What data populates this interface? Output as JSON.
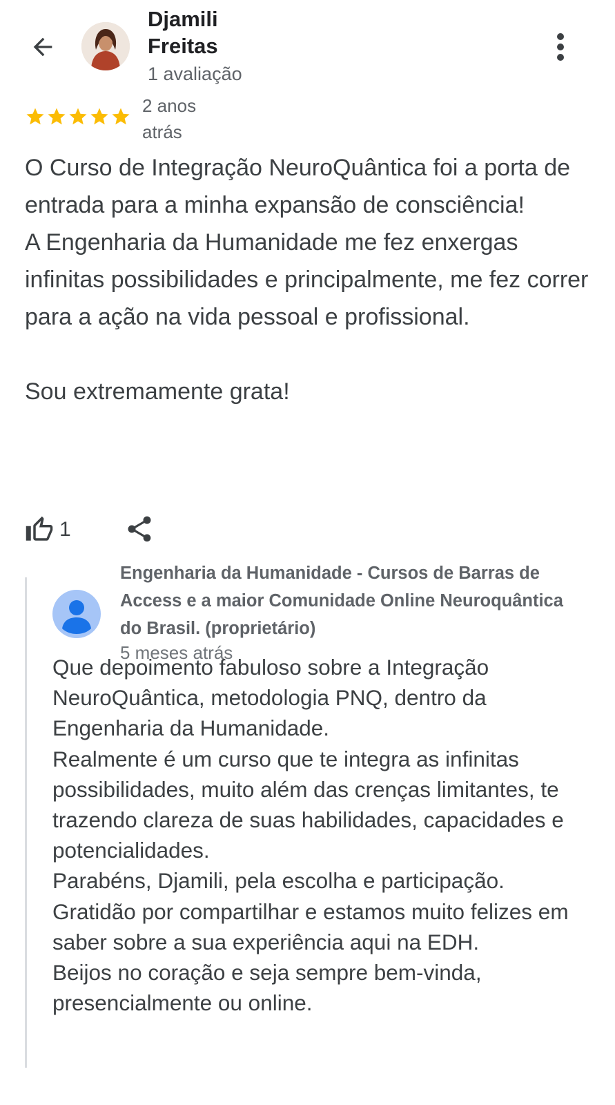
{
  "header": {
    "reviewer_name": "Djamili Freitas",
    "review_count": "1 avaliação",
    "back_icon": "arrow-left-icon",
    "more_icon": "more-vert-icon"
  },
  "review": {
    "rating": 5,
    "rating_max": 5,
    "star_color": "#fbbc04",
    "date": "2 anos atrás",
    "text": "O Curso de Integração NeuroQuântica foi a porta de entrada para a minha expansão de consciência!\nA Engenharia da Humanidade me fez enxergas infinitas possibilidades e principalmente, me fez correr para a ação na vida pessoal e profissional.\n\nSou extremamente grata!",
    "like_count": "1",
    "like_icon": "thumbs-up-icon",
    "share_icon": "share-icon"
  },
  "owner_reply": {
    "name": "Engenharia da Humanidade - Cursos de Barras de Access e a maior Comunidade Online Neuroquântica do Brasil. (proprietário)",
    "date": "5 meses atrás",
    "avatar_icon": "person-icon",
    "text": "Que depoimento fabuloso sobre a Integração NeuroQuântica, metodologia PNQ, dentro da Engenharia da Humanidade.\nRealmente é um curso que te integra as infinitas possibilidades, muito além das crenças limitantes, te trazendo clareza de suas habilidades, capacidades e potencialidades.\nParabéns, Djamili, pela escolha e participação.\nGratidão por compartilhar e estamos muito felizes em saber sobre a sua experiência aqui na EDH.\nBeijos no coração e seja sempre bem-vinda, presencialmente ou online."
  }
}
